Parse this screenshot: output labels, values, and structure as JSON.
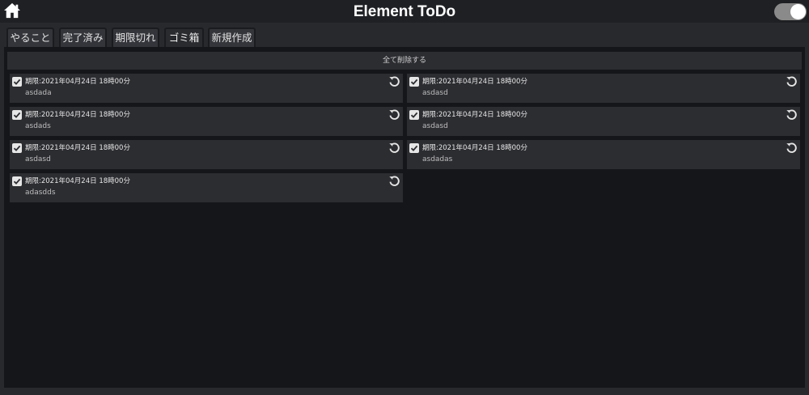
{
  "app": {
    "title": "Element ToDo",
    "home_icon": "home-icon",
    "theme_toggle_on": true
  },
  "tabs": [
    {
      "label": "やること"
    },
    {
      "label": "完了済み"
    },
    {
      "label": "期限切れ"
    },
    {
      "label": "ゴミ箱",
      "active": true
    },
    {
      "label": "新規作成"
    }
  ],
  "trash": {
    "delete_all_label": "全て削除する",
    "items": [
      {
        "deadline": "期限:2021年04月24日 18時00分",
        "text": "asdada",
        "checked": true
      },
      {
        "deadline": "期限:2021年04月24日 18時00分",
        "text": "asdasd",
        "checked": true
      },
      {
        "deadline": "期限:2021年04月24日 18時00分",
        "text": "asdads",
        "checked": true
      },
      {
        "deadline": "期限:2021年04月24日 18時00分",
        "text": "asdasd",
        "checked": true
      },
      {
        "deadline": "期限:2021年04月24日 18時00分",
        "text": "asdasd",
        "checked": true
      },
      {
        "deadline": "期限:2021年04月24日 18時00分",
        "text": "asdadas",
        "checked": true
      },
      {
        "deadline": "期限:2021年04月24日 18時00分",
        "text": "adasdds",
        "checked": true
      }
    ]
  },
  "colors": {
    "background": "#15161a",
    "card": "#2c2d31",
    "header": "#1f2023",
    "title": "#ffffff"
  }
}
